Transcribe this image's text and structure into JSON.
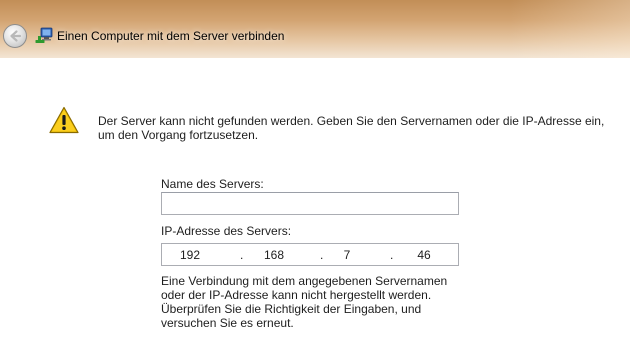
{
  "window": {
    "title": "Einen Computer mit dem Server verbinden",
    "back_icon": "back-arrow-icon",
    "app_icon": "network-computer-icon"
  },
  "main": {
    "warning_icon": "warning-icon",
    "message": "Der Server kann nicht gefunden werden. Geben Sie den Servernamen oder die IP-Adresse ein, um den Vorgang fortzusetzen.",
    "server_name_label": "Name des Servers:",
    "server_name_value": "",
    "ip_label": "IP-Adresse des Servers:",
    "ip_octets": [
      "192",
      "168",
      "7",
      "46"
    ],
    "ip_separator": ".",
    "error_text": "Eine Verbindung mit dem angegebenen Servernamen oder der IP-Adresse kann nicht hergestellt werden. Überprüfen Sie die Richtigkeit der Eingaben, und versuchen Sie es erneut."
  },
  "colors": {
    "titlebar_top": "#c28e57",
    "titlebar_bottom": "#f3e5d4",
    "warning_yellow": "#f5c400"
  }
}
